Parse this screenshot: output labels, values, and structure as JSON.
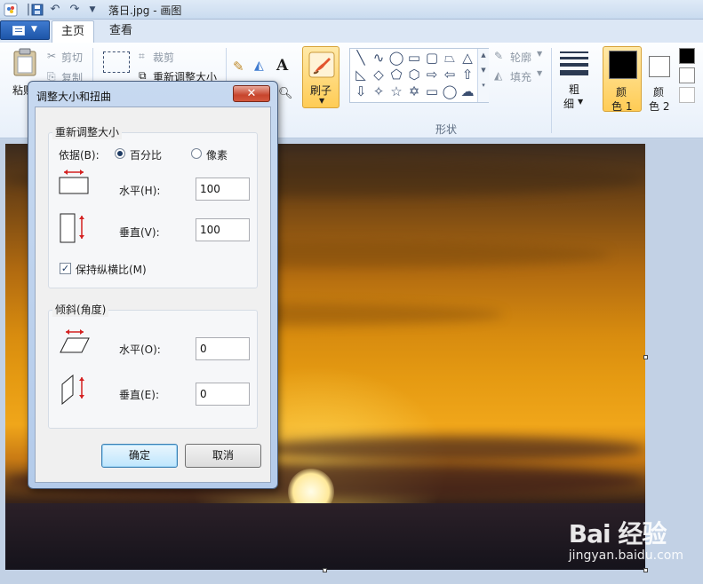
{
  "window": {
    "title": "落日.jpg - 画图"
  },
  "tabs": {
    "home": "主页",
    "view": "查看"
  },
  "ribbon": {
    "paste": "粘贴",
    "cut": "剪切",
    "copy": "复制",
    "crop": "裁剪",
    "resize": "重新调整大小",
    "brushes": "刷子",
    "shapes_group": "形状",
    "outline": "轮廓",
    "fill": "填充",
    "size_line1": "粗",
    "size_line2": "细",
    "color1_line1": "颜",
    "color1_line2": "色 1",
    "color2_line1": "颜",
    "color2_line2": "色 2",
    "colors": {
      "color1": "#000000",
      "color2": "#ffffff"
    }
  },
  "dialog": {
    "title": "调整大小和扭曲",
    "close": "✕",
    "resize_group": "重新调整大小",
    "by_label": "依据(B):",
    "percent": "百分比",
    "pixels": "像素",
    "horizontal_label": "水平(H):",
    "horizontal_value": "100",
    "vertical_label": "垂直(V):",
    "vertical_value": "100",
    "keep_ratio": "保持纵横比(M)",
    "skew_group": "倾斜(角度)",
    "skew_h_label": "水平(O):",
    "skew_h_value": "0",
    "skew_v_label": "垂直(E):",
    "skew_v_value": "0",
    "ok": "确定",
    "cancel": "取消"
  },
  "watermark": {
    "brand": "Bai 经验",
    "url": "jingyan.baidu.com"
  }
}
